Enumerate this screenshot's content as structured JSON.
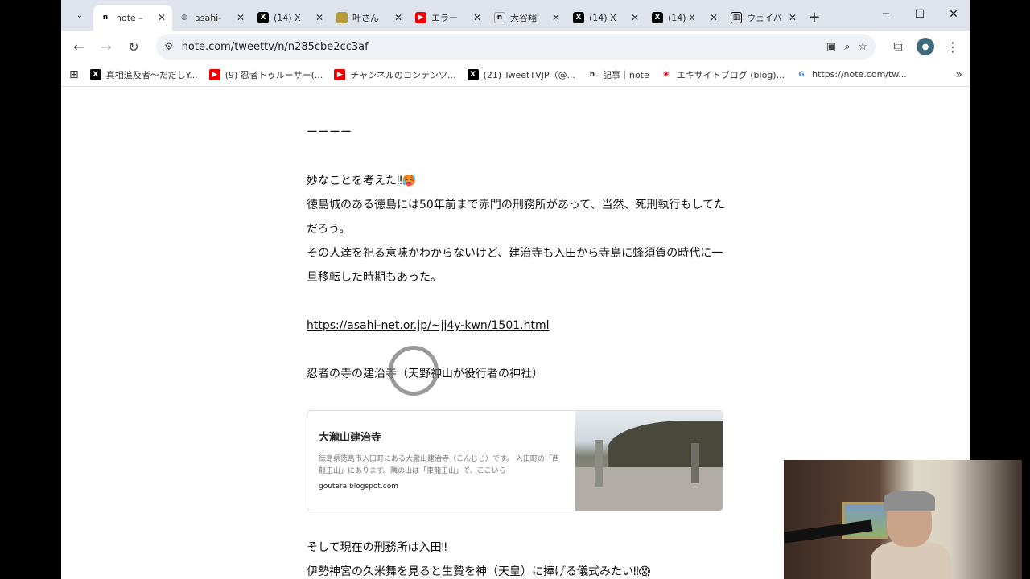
{
  "browser": {
    "tabs": [
      {
        "icon": "n",
        "title": "note –",
        "active": true
      },
      {
        "icon": "globe",
        "title": "asahi-",
        "active": false
      },
      {
        "icon": "X",
        "title": "(14) X",
        "active": false
      },
      {
        "icon": "img",
        "title": "叶さん",
        "active": false
      },
      {
        "icon": "yt",
        "title": "エラー",
        "active": false
      },
      {
        "icon": "n",
        "title": "大谷翔",
        "active": false
      },
      {
        "icon": "X",
        "title": "(14) X",
        "active": false
      },
      {
        "icon": "X",
        "title": "(14) X",
        "active": false
      },
      {
        "icon": "wiki",
        "title": "ウェイバ",
        "active": false
      }
    ],
    "url": "note.com/tweettv/n/n285cbe2cc3af",
    "bookmarks": [
      {
        "icon": "X",
        "label": "真相追及者〜ただしY..."
      },
      {
        "icon": "yt",
        "label": "(9) 忍者トゥルーサー(..."
      },
      {
        "icon": "yt",
        "label": "チャンネルのコンテンツ..."
      },
      {
        "icon": "X",
        "label": "(21) TweetTVJP（@..."
      },
      {
        "icon": "n",
        "label": "記事｜note"
      },
      {
        "icon": "excite",
        "label": "エキサイトブログ (blog)..."
      },
      {
        "icon": "G",
        "label": "https://note.com/tw..."
      }
    ]
  },
  "article": {
    "dashes": "ーーーー",
    "line1": "妙なことを考えた‼🥵",
    "line2": "徳島城のある徳島には50年前まで赤門の刑務所があって、当然、死刑執行もしてただろう。",
    "line3": "その人達を祀る意味かわからないけど、建治寺も入田から寺島に蜂須賀の時代に一旦移転した時期もあった。",
    "link": "https://asahi-net.or.jp/~jj4y-kwn/1501.html",
    "line4": "忍者の寺の建治寺（天野神山が役行者の神社）",
    "card": {
      "title": "大瀧山建治寺",
      "desc": "徳島県徳島市入田町にある大瀧山建治寺（こんじじ）です。 入田町の「西龍王山」にあります。隣の山は「東龍王山」で、ここいら",
      "domain": "goutara.blogspot.com"
    },
    "line5": "そして現在の刑務所は入田‼",
    "line6": "伊勢神宮の久米舞を見ると生贄を神（天皇）に捧げる儀式みたい‼😱"
  }
}
